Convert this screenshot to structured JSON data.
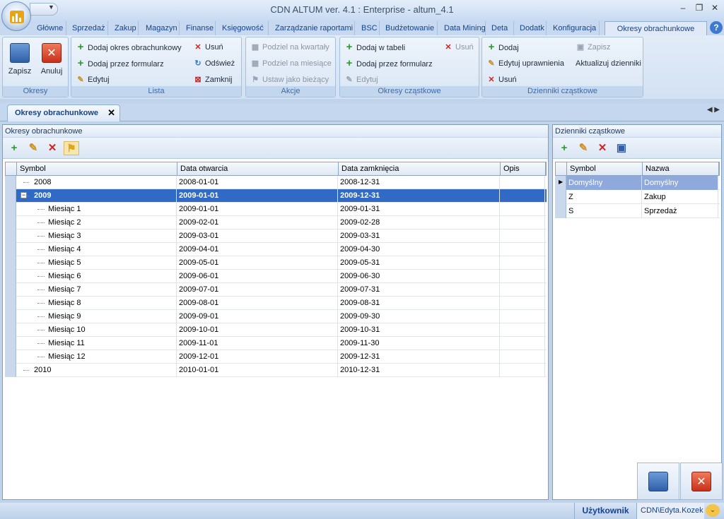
{
  "window": {
    "title": "CDN ALTUM ver. 4.1 : Enterprise - altum_4.1"
  },
  "tabs": [
    "Główne",
    "Sprzedaż",
    "Zakup",
    "Magazyn",
    "Finanse",
    "Księgowość",
    "Zarządzanie raportami",
    "BSC",
    "Budżetowanie",
    "Data Mining",
    "Deta",
    "Dodatk",
    "Konfiguracja",
    "Okresy obrachunkowe"
  ],
  "ribbon": {
    "okresy": {
      "save": "Zapisz",
      "cancel": "Anuluj",
      "label": "Okresy"
    },
    "lista": {
      "add_period": "Dodaj okres obrachunkowy",
      "add_form": "Dodaj przez formularz",
      "edit": "Edytuj",
      "delete": "Usuń",
      "refresh": "Odśwież",
      "close": "Zamknij",
      "label": "Lista"
    },
    "akcje": {
      "quarters": "Podziel na kwartały",
      "months": "Podziel na miesiące",
      "set_current": "Ustaw jako bieżący",
      "label": "Akcje"
    },
    "okresy_czastkowe": {
      "add_table": "Dodaj w tabeli",
      "add_form": "Dodaj przez formularz",
      "edit": "Edytuj",
      "delete": "Usuń",
      "label": "Okresy cząstkowe"
    },
    "dzienniki": {
      "add": "Dodaj",
      "edit_perm": "Edytuj uprawnienia",
      "delete": "Usuń",
      "save": "Zapisz",
      "update": "Aktualizuj dzienniki",
      "label": "Dzienniki cząstkowe"
    }
  },
  "doc_tab": "Okresy obrachunkowe",
  "left_panel": {
    "title": "Okresy obrachunkowe",
    "columns": [
      "Symbol",
      "Data otwarcia",
      "Data zamknięcia",
      "Opis"
    ],
    "rows": [
      {
        "symbol": "2008",
        "open": "2008-01-01",
        "close": "2008-12-31"
      },
      {
        "symbol": "2009",
        "open": "2009-01-01",
        "close": "2009-12-31"
      },
      {
        "symbol": "Miesiąc 1",
        "open": "2009-01-01",
        "close": "2009-01-31"
      },
      {
        "symbol": "Miesiąc 2",
        "open": "2009-02-01",
        "close": "2009-02-28"
      },
      {
        "symbol": "Miesiąc 3",
        "open": "2009-03-01",
        "close": "2009-03-31"
      },
      {
        "symbol": "Miesiąc 4",
        "open": "2009-04-01",
        "close": "2009-04-30"
      },
      {
        "symbol": "Miesiąc 5",
        "open": "2009-05-01",
        "close": "2009-05-31"
      },
      {
        "symbol": "Miesiąc 6",
        "open": "2009-06-01",
        "close": "2009-06-30"
      },
      {
        "symbol": "Miesiąc 7",
        "open": "2009-07-01",
        "close": "2009-07-31"
      },
      {
        "symbol": "Miesiąc 8",
        "open": "2009-08-01",
        "close": "2009-08-31"
      },
      {
        "symbol": "Miesiąc 9",
        "open": "2009-09-01",
        "close": "2009-09-30"
      },
      {
        "symbol": "Miesiąc 10",
        "open": "2009-10-01",
        "close": "2009-10-31"
      },
      {
        "symbol": "Miesiąc 11",
        "open": "2009-11-01",
        "close": "2009-11-30"
      },
      {
        "symbol": "Miesiąc 12",
        "open": "2009-12-01",
        "close": "2009-12-31"
      },
      {
        "symbol": "2010",
        "open": "2010-01-01",
        "close": "2010-12-31"
      }
    ]
  },
  "right_panel": {
    "title": "Dzienniki cząstkowe",
    "columns": [
      "Symbol",
      "Nazwa"
    ],
    "rows": [
      {
        "symbol": "Domyślny",
        "name": "Domyślny"
      },
      {
        "symbol": "Z",
        "name": "Zakup"
      },
      {
        "symbol": "S",
        "name": "Sprzedaż"
      }
    ]
  },
  "status": {
    "user_label": "Użytkownik",
    "user_value": "CDN\\Edyta.Kozek"
  }
}
